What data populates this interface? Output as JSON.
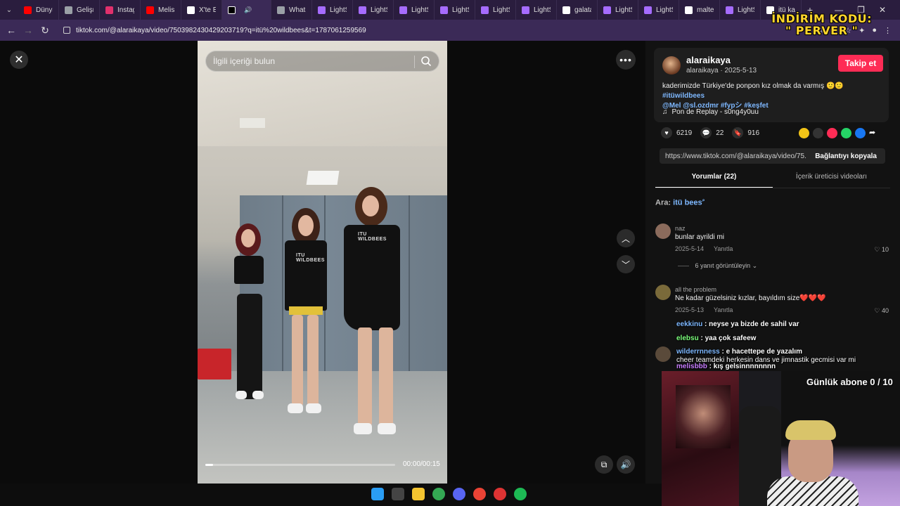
{
  "browser": {
    "tabs": [
      {
        "label": "Dünya",
        "icon": "youtube-icon",
        "color": "#ff0000"
      },
      {
        "label": "Gelişm",
        "icon": "globe-icon",
        "color": "#9aa0a6"
      },
      {
        "label": "Instagr",
        "icon": "instagram-icon",
        "color": "#e1306c"
      },
      {
        "label": "Melis F",
        "icon": "youtube-icon",
        "color": "#ff0000"
      },
      {
        "label": "X'te Esp",
        "icon": "x-icon",
        "color": "#ffffff"
      },
      {
        "label": "",
        "icon": "tiktok-icon",
        "color": "#000000",
        "active": true
      },
      {
        "label": "WhatsA",
        "icon": "globe-icon",
        "color": "#9aa0a6"
      },
      {
        "label": "LightSh",
        "icon": "pen-icon",
        "color": "#a66cff"
      },
      {
        "label": "LightSh",
        "icon": "pen-icon",
        "color": "#a66cff"
      },
      {
        "label": "LightSh",
        "icon": "pen-icon",
        "color": "#a66cff"
      },
      {
        "label": "LightSh",
        "icon": "pen-icon",
        "color": "#a66cff"
      },
      {
        "label": "LightSh",
        "icon": "pen-icon",
        "color": "#a66cff"
      },
      {
        "label": "LightSh",
        "icon": "pen-icon",
        "color": "#a66cff"
      },
      {
        "label": "galatas",
        "icon": "google-icon",
        "color": "#ffffff"
      },
      {
        "label": "LightSh",
        "icon": "pen-icon",
        "color": "#a66cff"
      },
      {
        "label": "LightSh",
        "icon": "pen-icon",
        "color": "#a66cff"
      },
      {
        "label": "maltep",
        "icon": "google-icon",
        "color": "#ffffff"
      },
      {
        "label": "LightSh",
        "icon": "pen-icon",
        "color": "#a66cff"
      },
      {
        "label": "itü kam",
        "icon": "google-icon",
        "color": "#ffffff"
      }
    ],
    "url": "tiktok.com/@alaraikaya/video/7503982430429203719?q=itü%20wildbees&t=1787061259569",
    "new_tab": "+"
  },
  "promo": {
    "line1": "İNDİRİM KODU:",
    "line2": "\" PERVER \""
  },
  "video": {
    "search_placeholder": "İlgili içeriği bulun",
    "time": "00:00/00:15",
    "progress": 0.04,
    "shirt_print": "ITU WILDBEES"
  },
  "author": {
    "username": "alaraikaya",
    "handle": "alaraikaya",
    "date": "2025-5-13",
    "follow_label": "Takip et",
    "caption_text": "kaderimizde Türkiye'de ponpon kız olmak da varmış 🙂🙂 ",
    "caption_tags": [
      "#itüwildbees",
      "@Mel",
      "@sl.ozdmr",
      "#fypシ",
      "#keşfet"
    ],
    "music": "Pon de Replay - s0ng4y0uu"
  },
  "stats": {
    "likes": "6219",
    "comments": "22",
    "saves": "916"
  },
  "share": {
    "link": "https://www.tiktok.com/@alaraikaya/video/75...",
    "copy_label": "Bağlantıyı kopyala",
    "colors": [
      "#f2c417",
      "#333333",
      "#fe2c55",
      "#25d366",
      "#1877f2"
    ]
  },
  "tabs": {
    "comments": "Yorumlar (22)",
    "creator_videos": "İçerik üreticisi videoları"
  },
  "search_tag": {
    "prefix": "Ara:",
    "value": "itü bees"
  },
  "comments": [
    {
      "user": "naz",
      "text": "bunlar ayrildi mi",
      "date": "2025-5-14",
      "reply": "Yanıtla",
      "likes": "10",
      "avatar_color": "#8b6b5c"
    },
    {
      "user": "all the problem",
      "text": "Ne kadar güzelsiniz kızlar, bayıldım size❤️❤️❤️",
      "date": "2025-5-13",
      "reply": "Yanıtla",
      "likes": "40",
      "avatar_color": "#7a6a3a"
    }
  ],
  "view_replies": "6 yanıt görüntüleyin",
  "stream_chat": [
    {
      "user": "eekkinu",
      "color": "#7eb8ff",
      "text": "neyse ya bizde de sahil var"
    },
    {
      "user": "elebsu",
      "color": "#7dff7d",
      "text": "yaa çok safeew"
    },
    {
      "user": "wilderrnness",
      "color": "#7eb8ff",
      "text": "e hacettepe de yazalım"
    },
    {
      "user": "",
      "color": "#ffffff",
      "text": "cheer teamdeki herkesin dans ve jimnastik gecmisi var mi"
    },
    {
      "user": "melisbbb",
      "color": "#c77dff",
      "text": "kış gelsinnnnnnnn"
    }
  ],
  "webcam": {
    "subs_label": "Günlük abone 0 / 10"
  },
  "taskbar": {
    "icons": [
      {
        "name": "windows-start-icon",
        "color": "#2a9df4"
      },
      {
        "name": "search-icon",
        "color": "#444444"
      },
      {
        "name": "file-explorer-icon",
        "color": "#f4c430"
      },
      {
        "name": "chrome-icon",
        "color": "#34a853"
      },
      {
        "name": "discord-icon",
        "color": "#5865f2"
      },
      {
        "name": "chrome-icon",
        "color": "#ea4335"
      },
      {
        "name": "recorder-icon",
        "color": "#d33"
      },
      {
        "name": "spotify-icon",
        "color": "#1db954"
      }
    ]
  }
}
